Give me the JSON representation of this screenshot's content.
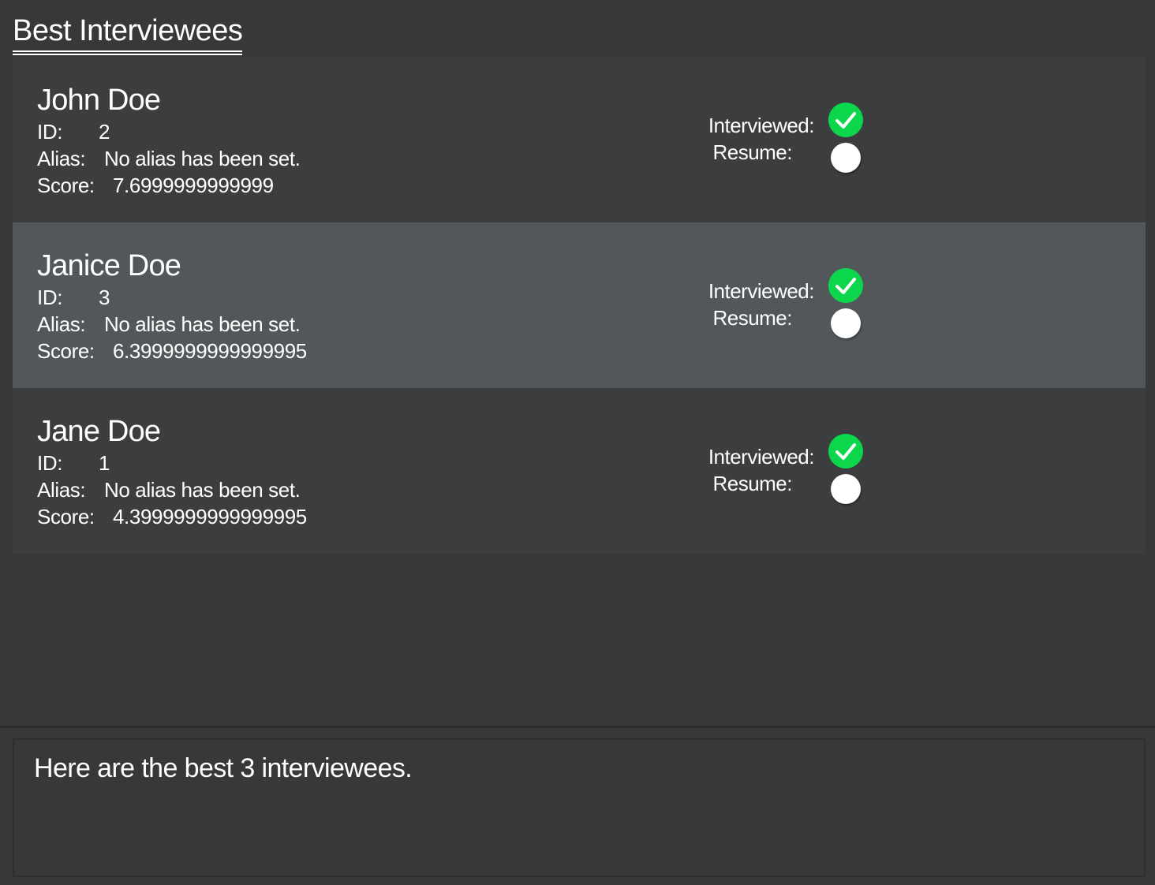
{
  "panel": {
    "title": "Best Interviewees"
  },
  "interviewees": [
    {
      "name": "John Doe",
      "id_label": "ID:",
      "id": "2",
      "alias_label": "Alias:",
      "alias": "No alias has been set.",
      "score_label": "Score:",
      "score": "7.6999999999999",
      "interviewed_label": "Interviewed:",
      "interviewed": true,
      "resume_label": "Resume:",
      "resume": false,
      "selected": false
    },
    {
      "name": "Janice Doe",
      "id_label": "ID:",
      "id": "3",
      "alias_label": "Alias:",
      "alias": "No alias has been set.",
      "score_label": "Score:",
      "score": "6.3999999999999995",
      "interviewed_label": "Interviewed:",
      "interviewed": true,
      "resume_label": "Resume:",
      "resume": false,
      "selected": true
    },
    {
      "name": "Jane Doe",
      "id_label": "ID:",
      "id": "1",
      "alias_label": "Alias:",
      "alias": "No alias has been set.",
      "score_label": "Score:",
      "score": "4.3999999999999995",
      "interviewed_label": "Interviewed:",
      "interviewed": true,
      "resume_label": "Resume:",
      "resume": false,
      "selected": false
    }
  ],
  "result": {
    "message": "Here are the best 3 interviewees."
  },
  "colors": {
    "background": "#383838",
    "card": "#3c3d3f",
    "card_selected": "#52575a",
    "check_green": "#0bd64c",
    "text": "#ffffff"
  },
  "icons": {
    "interviewed_true": "check-circle-icon",
    "resume_false": "empty-circle-icon"
  }
}
